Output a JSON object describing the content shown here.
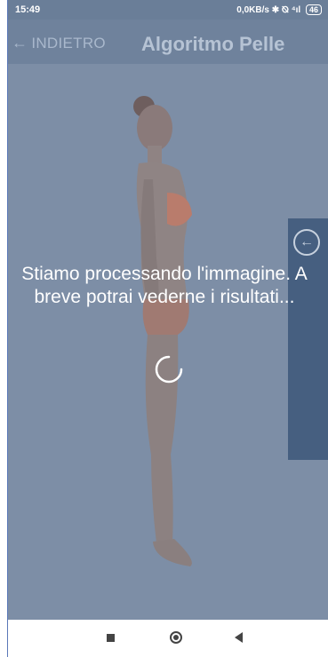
{
  "status_bar": {
    "time": "15:49",
    "indicators": "0,0KB/s ✱ ⦰ ⁴ıl",
    "battery": "46"
  },
  "header": {
    "back_label": "INDIETRO",
    "back_icon": "arrow-left-icon",
    "title": "Algoritmo Pelle"
  },
  "overlay": {
    "message": "Stiamo processando l'immagine. A breve potrai vederne i risultati..."
  },
  "drawer": {
    "icon": "arrow-left-circle-icon"
  },
  "navbar": {
    "recent_icon": "square-icon",
    "home_icon": "circle-icon",
    "back_icon": "triangle-back-icon"
  },
  "colors": {
    "overlay": "#7d8ea6",
    "drawer": "#465f80",
    "header_text": "#b6c3d4"
  }
}
